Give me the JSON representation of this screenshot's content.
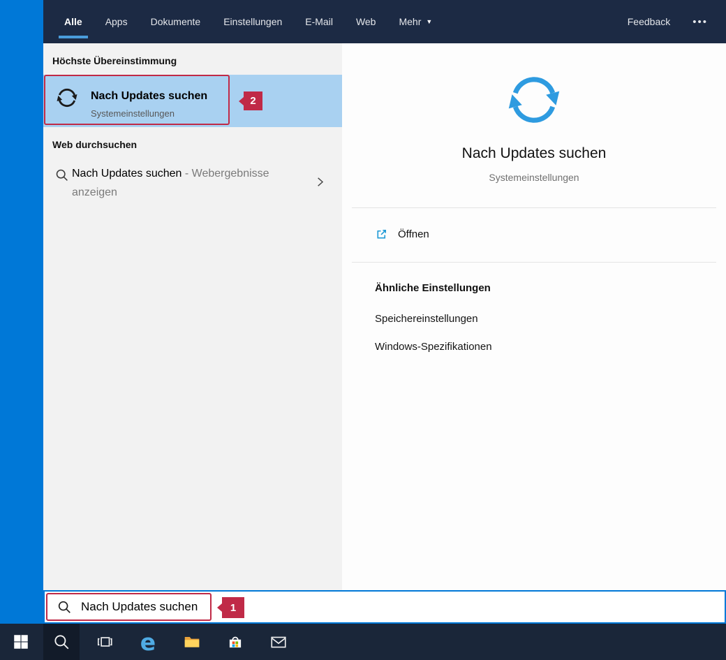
{
  "header": {
    "tabs": [
      {
        "label": "Alle",
        "active": true
      },
      {
        "label": "Apps"
      },
      {
        "label": "Dokumente"
      },
      {
        "label": "Einstellungen"
      },
      {
        "label": "E-Mail"
      },
      {
        "label": "Web"
      },
      {
        "label": "Mehr"
      }
    ],
    "feedback_label": "Feedback"
  },
  "left_pane": {
    "best_match_header": "Höchste Übereinstimmung",
    "best_match": {
      "title": "Nach Updates suchen",
      "subtitle": "Systemeinstellungen"
    },
    "web_section_header": "Web durchsuchen",
    "web_item": {
      "title": "Nach Updates suchen",
      "suffix": "- Webergebnisse anzeigen"
    }
  },
  "right_pane": {
    "title": "Nach Updates suchen",
    "subtitle": "Systemeinstellungen",
    "open_label": "Öffnen",
    "related_header": "Ähnliche Einstellungen",
    "related": [
      "Speichereinstellungen",
      "Windows-Spezifikationen"
    ]
  },
  "search_bar": {
    "value": "Nach Updates suchen"
  },
  "annotations": {
    "badge1": "1",
    "badge2": "2"
  },
  "icons": {
    "caret_down": "▼",
    "more": "•••",
    "edge_glyph": "e"
  },
  "colors": {
    "accent": "#0078D7",
    "annotation_red": "#C02A47",
    "selection_blue": "#A9D1F1",
    "header_bg": "#1C2A44",
    "taskbar_bg": "#1A2639"
  }
}
